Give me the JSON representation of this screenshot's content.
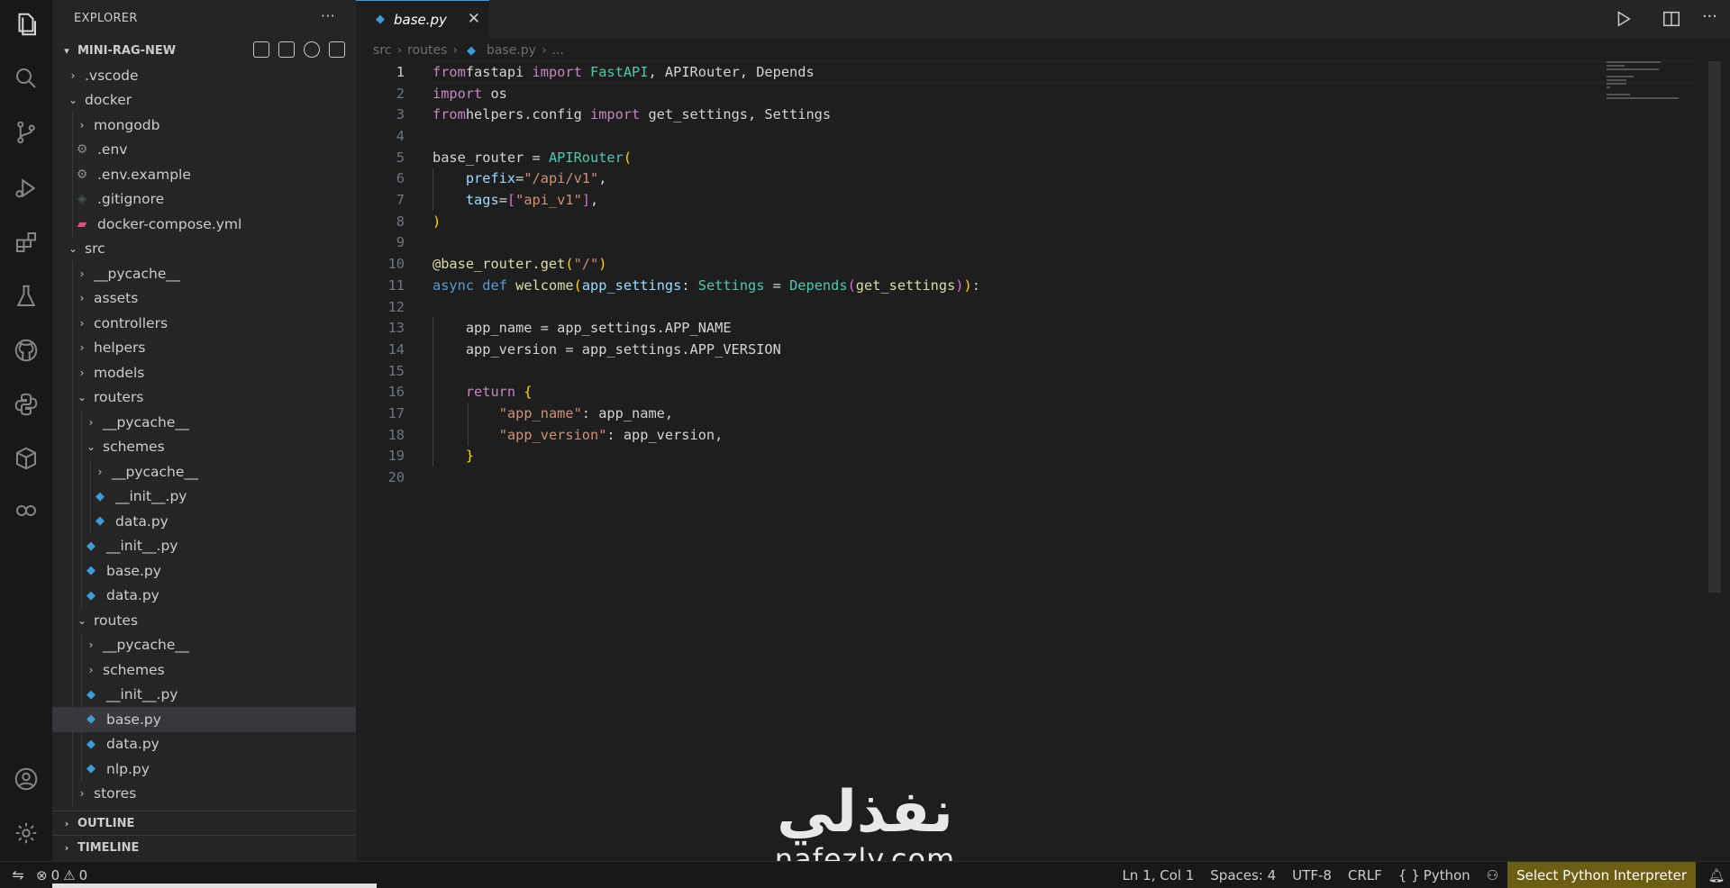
{
  "sidebar": {
    "title": "EXPLORER",
    "more": "···",
    "project": "MINI-RAG-NEW",
    "outline": "OUTLINE",
    "timeline": "TIMELINE",
    "tree": [
      {
        "label": ".vscode",
        "type": "folder",
        "open": false,
        "depth": 0
      },
      {
        "label": "docker",
        "type": "folder",
        "open": true,
        "depth": 0
      },
      {
        "label": "mongodb",
        "type": "folder",
        "open": false,
        "depth": 1
      },
      {
        "label": ".env",
        "type": "gear",
        "depth": 1
      },
      {
        "label": ".env.example",
        "type": "gear",
        "depth": 1
      },
      {
        "label": ".gitignore",
        "type": "git",
        "depth": 1
      },
      {
        "label": "docker-compose.yml",
        "type": "docker",
        "depth": 1
      },
      {
        "label": "src",
        "type": "folder",
        "open": true,
        "depth": 0
      },
      {
        "label": "__pycache__",
        "type": "folder",
        "open": false,
        "depth": 1
      },
      {
        "label": "assets",
        "type": "folder",
        "open": false,
        "depth": 1
      },
      {
        "label": "controllers",
        "type": "folder",
        "open": false,
        "depth": 1
      },
      {
        "label": "helpers",
        "type": "folder",
        "open": false,
        "depth": 1
      },
      {
        "label": "models",
        "type": "folder",
        "open": false,
        "depth": 1
      },
      {
        "label": "routers",
        "type": "folder",
        "open": true,
        "depth": 1
      },
      {
        "label": "__pycache__",
        "type": "folder",
        "open": false,
        "depth": 2
      },
      {
        "label": "schemes",
        "type": "folder",
        "open": true,
        "depth": 2
      },
      {
        "label": "__pycache__",
        "type": "folder",
        "open": false,
        "depth": 3
      },
      {
        "label": "__init__.py",
        "type": "py",
        "depth": 3
      },
      {
        "label": "data.py",
        "type": "py",
        "depth": 3
      },
      {
        "label": "__init__.py",
        "type": "py",
        "depth": 2
      },
      {
        "label": "base.py",
        "type": "py",
        "depth": 2
      },
      {
        "label": "data.py",
        "type": "py",
        "depth": 2
      },
      {
        "label": "routes",
        "type": "folder",
        "open": true,
        "depth": 1
      },
      {
        "label": "__pycache__",
        "type": "folder",
        "open": false,
        "depth": 2
      },
      {
        "label": "schemes",
        "type": "folder",
        "open": false,
        "depth": 2
      },
      {
        "label": "__init__.py",
        "type": "py",
        "depth": 2
      },
      {
        "label": "base.py",
        "type": "py",
        "depth": 2,
        "selected": true
      },
      {
        "label": "data.py",
        "type": "py",
        "depth": 2
      },
      {
        "label": "nlp.py",
        "type": "py",
        "depth": 2
      },
      {
        "label": "stores",
        "type": "folder",
        "open": false,
        "depth": 1
      }
    ]
  },
  "tab": {
    "label": "base.py",
    "close": "✕"
  },
  "breadcrumb": [
    "src",
    "routes",
    "base.py",
    "..."
  ],
  "code": [
    [
      [
        "kw",
        "from"
      ],
      [
        "",
        "fastapi "
      ],
      [
        "kw",
        "import"
      ],
      [
        "cls",
        " FastAPI"
      ],
      [
        "",
        ", APIRouter, Depends"
      ]
    ],
    [
      [
        "kw",
        "import"
      ],
      [
        "",
        " os"
      ]
    ],
    [
      [
        "kw",
        "from"
      ],
      [
        "",
        "",
        " "
      ],
      [
        "",
        "helpers.config "
      ],
      [
        "kw",
        "import"
      ],
      [
        "",
        " get_settings, Settings"
      ]
    ],
    [],
    [
      [
        "",
        "base_router = "
      ],
      [
        "cls",
        "APIRouter"
      ],
      [
        "b1",
        "("
      ]
    ],
    [
      [
        "",
        "    "
      ],
      [
        "var",
        "prefix"
      ],
      [
        "",
        "="
      ],
      [
        "str",
        "\"/api/v1\""
      ],
      [
        "",
        ","
      ]
    ],
    [
      [
        "",
        "    "
      ],
      [
        "var",
        "tags"
      ],
      [
        "",
        "="
      ],
      [
        "b2",
        "["
      ],
      [
        "str",
        "\"api_v1\""
      ],
      [
        "b2",
        "]"
      ],
      [
        "",
        ","
      ]
    ],
    [
      [
        "b1",
        ")"
      ]
    ],
    [],
    [
      [
        "fn",
        "@base_router.get"
      ],
      [
        "b1",
        "("
      ],
      [
        "str",
        "\"/\""
      ],
      [
        "b1",
        ")"
      ]
    ],
    [
      [
        "kw2",
        "async"
      ],
      [
        "",
        " "
      ],
      [
        "kw2",
        "def"
      ],
      [
        "",
        " "
      ],
      [
        "fn",
        "welcome"
      ],
      [
        "b1",
        "("
      ],
      [
        "var",
        "app_settings"
      ],
      [
        "",
        ": "
      ],
      [
        "cls",
        "Settings"
      ],
      [
        "",
        " = "
      ],
      [
        "cls",
        "Depends"
      ],
      [
        "b2",
        "("
      ],
      [
        "fn",
        "get_settings"
      ],
      [
        "b2",
        ")"
      ],
      [
        "b1",
        ")"
      ],
      [
        "",
        ":"
      ]
    ],
    [],
    [
      [
        "",
        "    app_name = app_settings.APP_NAME"
      ]
    ],
    [
      [
        "",
        "    app_version = app_settings.APP_VERSION"
      ]
    ],
    [],
    [
      [
        "",
        "    "
      ],
      [
        "kw",
        "return"
      ],
      [
        "",
        " "
      ],
      [
        "b1",
        "{"
      ]
    ],
    [
      [
        "",
        "        "
      ],
      [
        "str",
        "\"app_name\""
      ],
      [
        "",
        ": app_name,"
      ]
    ],
    [
      [
        "",
        "        "
      ],
      [
        "str",
        "\"app_version\""
      ],
      [
        "",
        ": app_version,"
      ]
    ],
    [
      [
        "",
        "    "
      ],
      [
        "b1",
        "}"
      ]
    ],
    []
  ],
  "watermark": {
    "arabic": "نفذلي",
    "latin": "nafezly.com"
  },
  "status": {
    "errors": "0",
    "warnings": "0",
    "position": "Ln 1, Col 1",
    "spaces": "Spaces: 4",
    "encoding": "UTF-8",
    "eol": "CRLF",
    "language_glyph": "{ }",
    "language": "Python",
    "interpreter": "Select Python Interpreter"
  },
  "colors": {
    "accent": "#3e9ad6",
    "interpreter_bg": "#6b5d12"
  }
}
